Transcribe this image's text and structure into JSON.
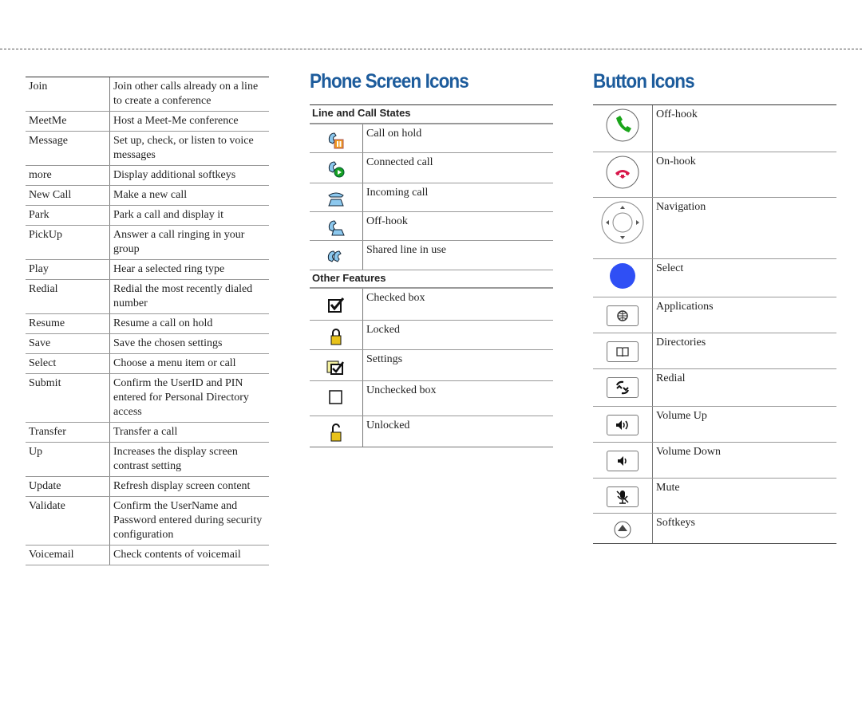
{
  "softkeys": [
    {
      "key": "Join",
      "desc": "Join other calls already on a line to create a conference"
    },
    {
      "key": "MeetMe",
      "desc": "Host a Meet-Me conference"
    },
    {
      "key": "Message",
      "desc": "Set up, check, or listen to voice messages"
    },
    {
      "key": "more",
      "desc": "Display additional softkeys"
    },
    {
      "key": "New Call",
      "desc": "Make a new call"
    },
    {
      "key": "Park",
      "desc": "Park a call and display it"
    },
    {
      "key": "PickUp",
      "desc": "Answer a call ringing in your group"
    },
    {
      "key": "Play",
      "desc": "Hear a selected ring type"
    },
    {
      "key": "Redial",
      "desc": "Redial the most recently dialed number"
    },
    {
      "key": "Resume",
      "desc": "Resume a call on hold"
    },
    {
      "key": "Save",
      "desc": "Save the chosen settings"
    },
    {
      "key": "Select",
      "desc": "Choose a menu item or call"
    },
    {
      "key": "Submit",
      "desc": "Confirm the UserID and PIN entered for Personal Directory access"
    },
    {
      "key": "Transfer",
      "desc": "Transfer a call"
    },
    {
      "key": "Up",
      "desc": "Increases the display screen contrast setting"
    },
    {
      "key": "Update",
      "desc": "Refresh display screen content"
    },
    {
      "key": "Validate",
      "desc": "Confirm the UserName and Password entered during security configuration"
    },
    {
      "key": "Voicemail",
      "desc": "Check contents of voicemail"
    }
  ],
  "phone_screen": {
    "title": "Phone Screen Icons",
    "line_section": "Line and Call States",
    "line_items": [
      {
        "icon": "call-on-hold-icon",
        "label": "Call on hold"
      },
      {
        "icon": "connected-call-icon",
        "label": "Connected call"
      },
      {
        "icon": "incoming-call-icon",
        "label": "Incoming call"
      },
      {
        "icon": "off-hook-icon",
        "label": "Off-hook"
      },
      {
        "icon": "shared-line-icon",
        "label": "Shared line in use"
      }
    ],
    "other_section": "Other Features",
    "other_items": [
      {
        "icon": "checked-box-icon",
        "label": "Checked box"
      },
      {
        "icon": "locked-icon",
        "label": "Locked"
      },
      {
        "icon": "settings-icon",
        "label": "Settings"
      },
      {
        "icon": "unchecked-box-icon",
        "label": "Unchecked box"
      },
      {
        "icon": "unlocked-icon",
        "label": "Unlocked"
      }
    ]
  },
  "button_icons": {
    "title": "Button Icons",
    "items": [
      {
        "icon": "off-hook-button-icon",
        "label": "Off-hook"
      },
      {
        "icon": "on-hook-button-icon",
        "label": "On-hook"
      },
      {
        "icon": "navigation-button-icon",
        "label": "Navigation"
      },
      {
        "icon": "select-button-icon",
        "label": "Select"
      },
      {
        "icon": "applications-button-icon",
        "label": "Applications"
      },
      {
        "icon": "directories-button-icon",
        "label": "Directories"
      },
      {
        "icon": "redial-button-icon",
        "label": "Redial"
      },
      {
        "icon": "volume-up-button-icon",
        "label": "Volume Up"
      },
      {
        "icon": "volume-down-button-icon",
        "label": "Volume Down"
      },
      {
        "icon": "mute-button-icon",
        "label": "Mute"
      },
      {
        "icon": "softkeys-button-icon",
        "label": "Softkeys"
      }
    ]
  },
  "colors": {
    "title": "#1d5c9c",
    "select": "#2f4ff5",
    "offhook": "#1aa51a",
    "onhook": "#d8174a"
  }
}
